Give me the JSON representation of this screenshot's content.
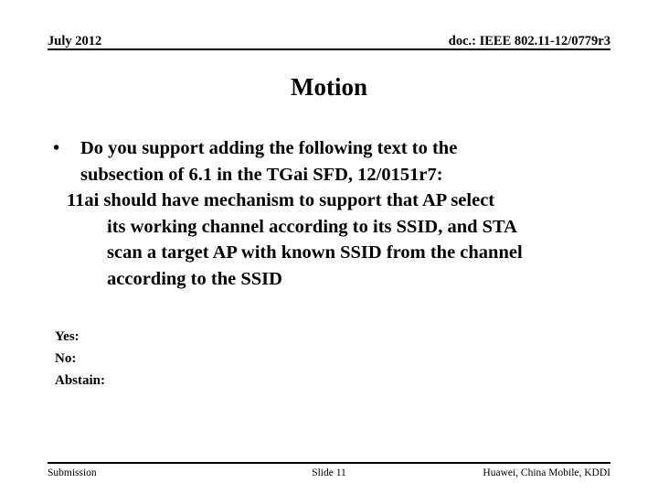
{
  "header": {
    "date": "July 2012",
    "doc_id": "doc.: IEEE 802.11-12/0779r3"
  },
  "title": "Motion",
  "body": {
    "bullet_marker": "•",
    "bullet": {
      "line1": "Do you support adding the following text to the",
      "line2": "subsection of 6.1 in the TGai SFD, 12/0151r7:"
    },
    "quote": {
      "line1": "11ai should have mechanism to support that AP select",
      "line2": "its working channel according to its SSID, and STA",
      "line3": "scan a target AP with known SSID from the channel",
      "line4": "according to the SSID"
    }
  },
  "vote": {
    "yes": "Yes:",
    "no": "No:",
    "abstain": "Abstain:"
  },
  "footer": {
    "left": "Submission",
    "center": "Slide 11",
    "right": "Huawei, China Mobile, KDDI"
  },
  "colors": {
    "text": "#000000",
    "background": "#ffffff",
    "rule": "#000000"
  }
}
